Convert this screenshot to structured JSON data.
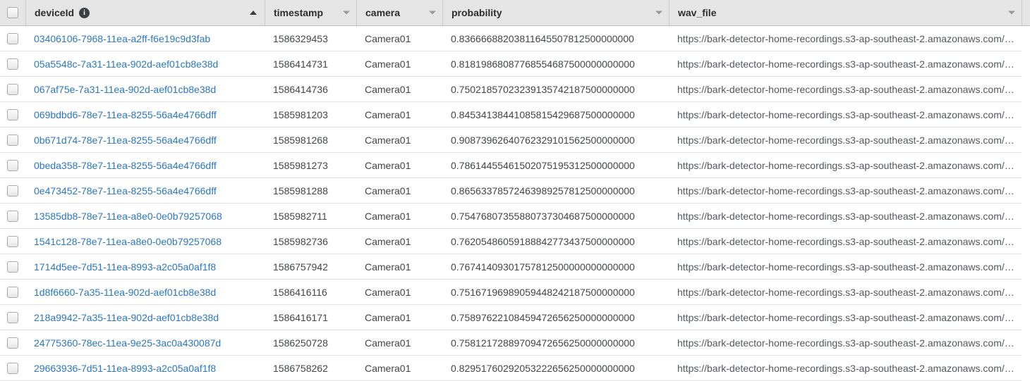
{
  "header": {
    "columns": [
      {
        "label": "deviceId",
        "sort": "ascending",
        "has_info": true
      },
      {
        "label": "timestamp",
        "sort": "menu"
      },
      {
        "label": "camera",
        "sort": "menu"
      },
      {
        "label": "probability",
        "sort": "menu"
      },
      {
        "label": "wav_file",
        "sort": "menu"
      }
    ]
  },
  "icons": {
    "info_glyph": "i"
  },
  "colors": {
    "link": "#2b77c0",
    "header_bg": "#e5e5e5",
    "row_border": "#e2e2e2"
  },
  "rows": [
    {
      "deviceId": "03406106-7968-11ea-a2ff-f6e19c9d3fab",
      "timestamp": "1586329453",
      "camera": "Camera01",
      "probability": "0.83666688203811645507812500000000",
      "wav_file": "https://bark-detector-home-recordings.s3-ap-southeast-2.amazonaws.com/…"
    },
    {
      "deviceId": "05a5548c-7a31-11ea-902d-aef01cb8e38d",
      "timestamp": "1586414731",
      "camera": "Camera01",
      "probability": "0.81819868087768554687500000000000",
      "wav_file": "https://bark-detector-home-recordings.s3-ap-southeast-2.amazonaws.com/…"
    },
    {
      "deviceId": "067af75e-7a31-11ea-902d-aef01cb8e38d",
      "timestamp": "1586414736",
      "camera": "Camera01",
      "probability": "0.75021857023239135742187500000000",
      "wav_file": "https://bark-detector-home-recordings.s3-ap-southeast-2.amazonaws.com/…"
    },
    {
      "deviceId": "069bdbd6-78e7-11ea-8255-56a4e4766dff",
      "timestamp": "1585981203",
      "camera": "Camera01",
      "probability": "0.84534138441085815429687500000000",
      "wav_file": "https://bark-detector-home-recordings.s3-ap-southeast-2.amazonaws.com/…"
    },
    {
      "deviceId": "0b671d74-78e7-11ea-8255-56a4e4766dff",
      "timestamp": "1585981268",
      "camera": "Camera01",
      "probability": "0.90873962640762329101562500000000",
      "wav_file": "https://bark-detector-home-recordings.s3-ap-southeast-2.amazonaws.com/…"
    },
    {
      "deviceId": "0beda358-78e7-11ea-8255-56a4e4766dff",
      "timestamp": "1585981273",
      "camera": "Camera01",
      "probability": "0.78614455461502075195312500000000",
      "wav_file": "https://bark-detector-home-recordings.s3-ap-southeast-2.amazonaws.com/…"
    },
    {
      "deviceId": "0e473452-78e7-11ea-8255-56a4e4766dff",
      "timestamp": "1585981288",
      "camera": "Camera01",
      "probability": "0.86563378572463989257812500000000",
      "wav_file": "https://bark-detector-home-recordings.s3-ap-southeast-2.amazonaws.com/…"
    },
    {
      "deviceId": "13585db8-78e7-11ea-a8e0-0e0b79257068",
      "timestamp": "1585982711",
      "camera": "Camera01",
      "probability": "0.75476807355880737304687500000000",
      "wav_file": "https://bark-detector-home-recordings.s3-ap-southeast-2.amazonaws.com/…"
    },
    {
      "deviceId": "1541c128-78e7-11ea-a8e0-0e0b79257068",
      "timestamp": "1585982736",
      "camera": "Camera01",
      "probability": "0.76205486059188842773437500000000",
      "wav_file": "https://bark-detector-home-recordings.s3-ap-southeast-2.amazonaws.com/…"
    },
    {
      "deviceId": "1714d5ee-7d51-11ea-8993-a2c05a0af1f8",
      "timestamp": "1586757942",
      "camera": "Camera01",
      "probability": "0.76741409301757812500000000000000",
      "wav_file": "https://bark-detector-home-recordings.s3-ap-southeast-2.amazonaws.com/…"
    },
    {
      "deviceId": "1d8f6660-7a35-11ea-902d-aef01cb8e38d",
      "timestamp": "1586416116",
      "camera": "Camera01",
      "probability": "0.75167196989059448242187500000000",
      "wav_file": "https://bark-detector-home-recordings.s3-ap-southeast-2.amazonaws.com/…"
    },
    {
      "deviceId": "218a9942-7a35-11ea-902d-aef01cb8e38d",
      "timestamp": "1586416171",
      "camera": "Camera01",
      "probability": "0.75897622108459472656250000000000",
      "wav_file": "https://bark-detector-home-recordings.s3-ap-southeast-2.amazonaws.com/…"
    },
    {
      "deviceId": "24775360-78ec-11ea-9e25-3ac0a430087d",
      "timestamp": "1586250728",
      "camera": "Camera01",
      "probability": "0.75812172889709472656250000000000",
      "wav_file": "https://bark-detector-home-recordings.s3-ap-southeast-2.amazonaws.com/…"
    },
    {
      "deviceId": "29663936-7d51-11ea-8993-a2c05a0af1f8",
      "timestamp": "1586758262",
      "camera": "Camera01",
      "probability": "0.82951760292053222656250000000000",
      "wav_file": "https://bark-detector-home-recordings.s3-ap-southeast-2.amazonaws.com/…"
    }
  ]
}
